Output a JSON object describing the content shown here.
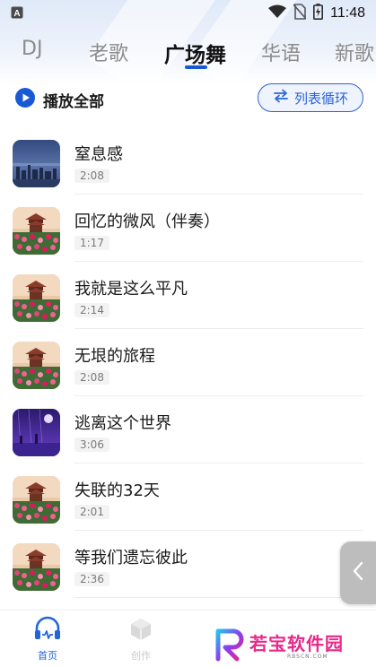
{
  "status_bar": {
    "time": "11:48",
    "icons": [
      "app-a-icon",
      "wifi-icon",
      "no-sim-icon",
      "battery-charging-icon"
    ]
  },
  "tabs": [
    {
      "label": "DJ",
      "active": false
    },
    {
      "label": "老歌",
      "active": false
    },
    {
      "label": "广场舞",
      "active": true
    },
    {
      "label": "华语",
      "active": false
    },
    {
      "label": "新歌",
      "active": false
    }
  ],
  "controls": {
    "play_all_label": "播放全部",
    "play_mode_label": "列表循环"
  },
  "songs": [
    {
      "title": "窒息感",
      "duration": "2:08",
      "cover": "city-skyline-cover"
    },
    {
      "title": "回忆的微风（伴奏）",
      "duration": "1:17",
      "cover": "pavilion-flowers-cover"
    },
    {
      "title": "我就是这么平凡",
      "duration": "2:14",
      "cover": "pavilion-flowers-cover"
    },
    {
      "title": "无垠的旅程",
      "duration": "2:08",
      "cover": "pavilion-flowers-cover"
    },
    {
      "title": "逃离这个世界",
      "duration": "3:06",
      "cover": "purple-night-cover"
    },
    {
      "title": "失联的32天",
      "duration": "2:01",
      "cover": "pavilion-flowers-cover"
    },
    {
      "title": "等我们遗忘彼此",
      "duration": "2:36",
      "cover": "pavilion-flowers-cover"
    }
  ],
  "bottom_nav": [
    {
      "label": "首页",
      "icon": "home-music-icon",
      "active": true
    },
    {
      "label": "创作",
      "icon": "cube-icon",
      "active": false
    }
  ],
  "watermark": {
    "text": "若宝软件园",
    "sub": "RBSCN.COM"
  },
  "colors": {
    "accent": "#1a59d6",
    "watermark_pink": "#e8288a"
  }
}
